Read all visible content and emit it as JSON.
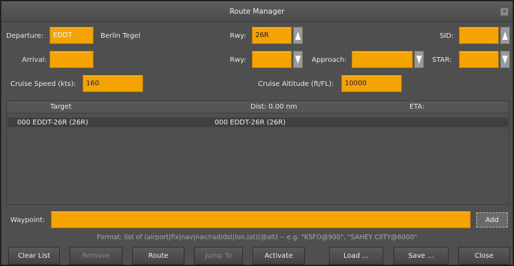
{
  "window": {
    "title": "Route Manager"
  },
  "departure": {
    "label": "Departure:",
    "code": "EDDT",
    "name": "Berlin Tegel"
  },
  "arrival": {
    "label": "Arrival:",
    "code": ""
  },
  "runway_dep": {
    "label": "Rwy:",
    "value": "26R"
  },
  "runway_arr": {
    "label": "Rwy:",
    "value": ""
  },
  "sid": {
    "label": "SID:",
    "value": ""
  },
  "star": {
    "label": "STAR:",
    "value": ""
  },
  "approach": {
    "label": "Approach:",
    "value": ""
  },
  "cruise_speed": {
    "label": "Cruise Speed (kts):",
    "value": "160"
  },
  "cruise_alt": {
    "label": "Cruise Altitude (ft/FL):",
    "value": "10000"
  },
  "route_list": {
    "headers": {
      "target": "Target",
      "dist": "Dist: 0.00 nm",
      "eta": "ETA:"
    },
    "rows": [
      {
        "col1": "000   EDDT-26R (26R)",
        "col2": "000   EDDT-26R (26R)"
      }
    ]
  },
  "waypoint": {
    "label": "Waypoint:",
    "value": "",
    "add_label": "Add"
  },
  "format_hint": "Format: list of (airport|fix|nav|nav/rad/dst|lon,lat)(@alt) -- e.g. \"KSFO@900\", \"SAHEY CIITY@6000\"",
  "buttons": {
    "clear_list": "Clear List",
    "remove": "Remove",
    "route": "Route",
    "jump_to": "Jump To",
    "activate": "Activate",
    "load": "Load ...",
    "save": "Save ...",
    "close": "Close"
  },
  "colors": {
    "field": "#f5a300",
    "background": "#4f4f4f",
    "row_selected": "#3f3f3f"
  }
}
